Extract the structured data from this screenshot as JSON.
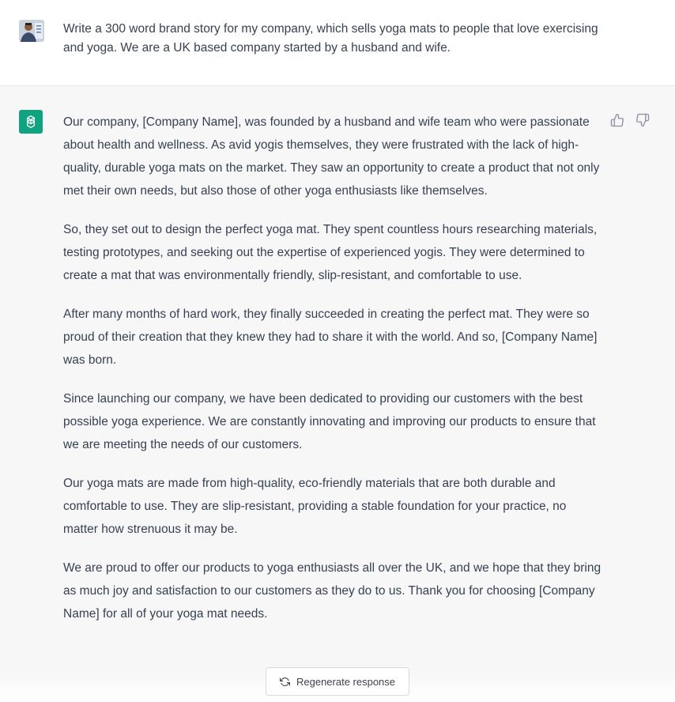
{
  "user_message": {
    "text": "Write a 300 word brand story for my company, which sells yoga mats to people that love exercising and yoga. We are a UK based company started by a husband and wife.",
    "avatar_icon": "user-avatar-photo"
  },
  "assistant_message": {
    "logo_icon": "openai-logo-icon",
    "paragraphs": [
      "Our company, [Company Name], was founded by a husband and wife team who were passionate about health and wellness. As avid yogis themselves, they were frustrated with the lack of high-quality, durable yoga mats on the market. They saw an opportunity to create a product that not only met their own needs, but also those of other yoga enthusiasts like themselves.",
      "So, they set out to design the perfect yoga mat. They spent countless hours researching materials, testing prototypes, and seeking out the expertise of experienced yogis. They were determined to create a mat that was environmentally friendly, slip-resistant, and comfortable to use.",
      "After many months of hard work, they finally succeeded in creating the perfect mat. They were so proud of their creation that they knew they had to share it with the world. And so, [Company Name] was born.",
      "Since launching our company, we have been dedicated to providing our customers with the best possible yoga experience. We are constantly innovating and improving our products to ensure that we are meeting the needs of our customers.",
      "Our yoga mats are made from high-quality, eco-friendly materials that are both durable and comfortable to use. They are slip-resistant, providing a stable foundation for your practice, no matter how strenuous it may be.",
      "We are proud to offer our products to yoga enthusiasts all over the UK, and we hope that they bring as much joy and satisfaction to our customers as they do to us. Thank you for choosing [Company Name] for all of your yoga mat needs."
    ],
    "feedback_icons": [
      "thumbs-up-icon",
      "thumbs-down-icon"
    ]
  },
  "regenerate": {
    "label": "Regenerate response",
    "icon": "refresh-icon"
  },
  "colors": {
    "assistant_bg": "#f7f7f8",
    "logo_bg": "#10a37f",
    "text": "#374151"
  }
}
